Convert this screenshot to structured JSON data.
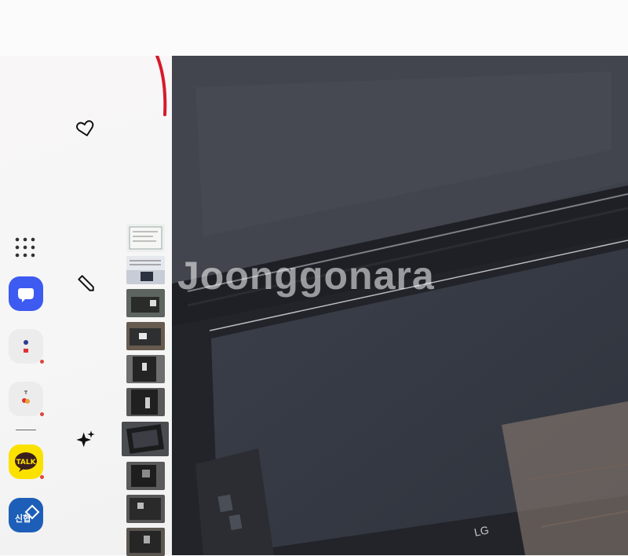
{
  "watermark": "Joonggonara",
  "edge_panel": {
    "tools": [
      {
        "icon": "heart-icon"
      },
      {
        "icon": "pencil-icon"
      },
      {
        "icon": "sparkle-icon"
      }
    ],
    "apps": [
      {
        "icon": "app-drawer-icon"
      },
      {
        "icon": "bixby-chat-icon",
        "color": "#3d5af1"
      },
      {
        "icon": "app-icon-1",
        "badge": true
      },
      {
        "icon": "app-icon-2",
        "badge": true
      },
      {
        "icon": "kakaotalk-icon",
        "label": "TALK",
        "color": "#fae100",
        "badge": true
      },
      {
        "icon": "bank-app-icon",
        "label": "신협",
        "color": "#1d5fb8"
      }
    ],
    "thumbnails_count": 10
  },
  "colors": {
    "accent_red": "#d7192b",
    "photo_bg": "#3a3d45"
  }
}
